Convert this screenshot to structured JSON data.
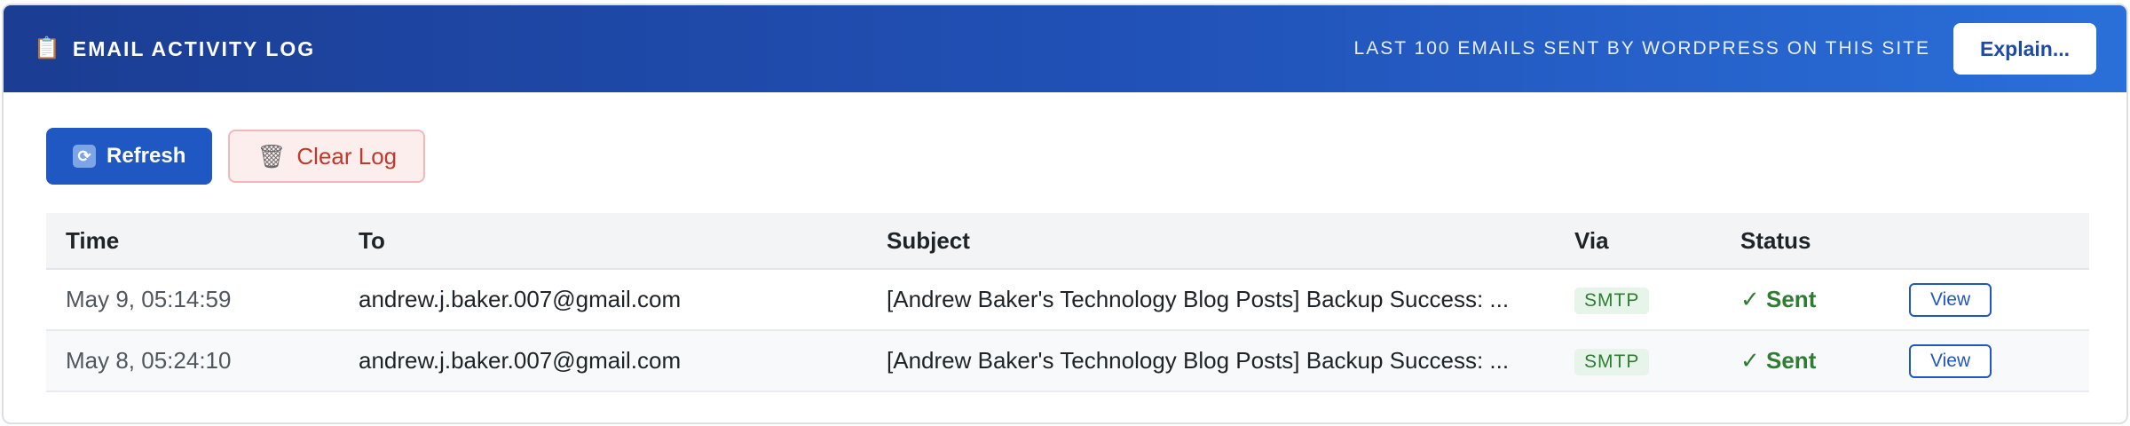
{
  "header": {
    "icon": "clipboard-icon",
    "title": "EMAIL ACTIVITY LOG",
    "subtitle": "LAST 100 EMAILS SENT BY WORDPRESS ON THIS SITE",
    "explain_label": "Explain...",
    "gradient_colors": [
      "#1b3d93",
      "#2a6fd9"
    ]
  },
  "toolbar": {
    "refresh_label": "Refresh",
    "refresh_icon": "refresh-icon",
    "clear_label": "Clear Log",
    "clear_icon": "wastebasket-icon"
  },
  "table": {
    "columns": [
      "Time",
      "To",
      "Subject",
      "Via",
      "Status",
      ""
    ],
    "rows": [
      {
        "time": "May 9, 05:14:59",
        "to": "andrew.j.baker.007@gmail.com",
        "subject": "[Andrew Baker's Technology Blog Posts] Backup Success: ...",
        "via": "SMTP",
        "status": "✓ Sent",
        "action": "View"
      },
      {
        "time": "May 8, 05:24:10",
        "to": "andrew.j.baker.007@gmail.com",
        "subject": "[Andrew Baker's Technology Blog Posts] Backup Success: ...",
        "via": "SMTP",
        "status": "✓ Sent",
        "action": "View"
      }
    ]
  },
  "colors": {
    "accent": "#1f58c2",
    "success": "#2e7d32",
    "danger": "#c0392b"
  }
}
